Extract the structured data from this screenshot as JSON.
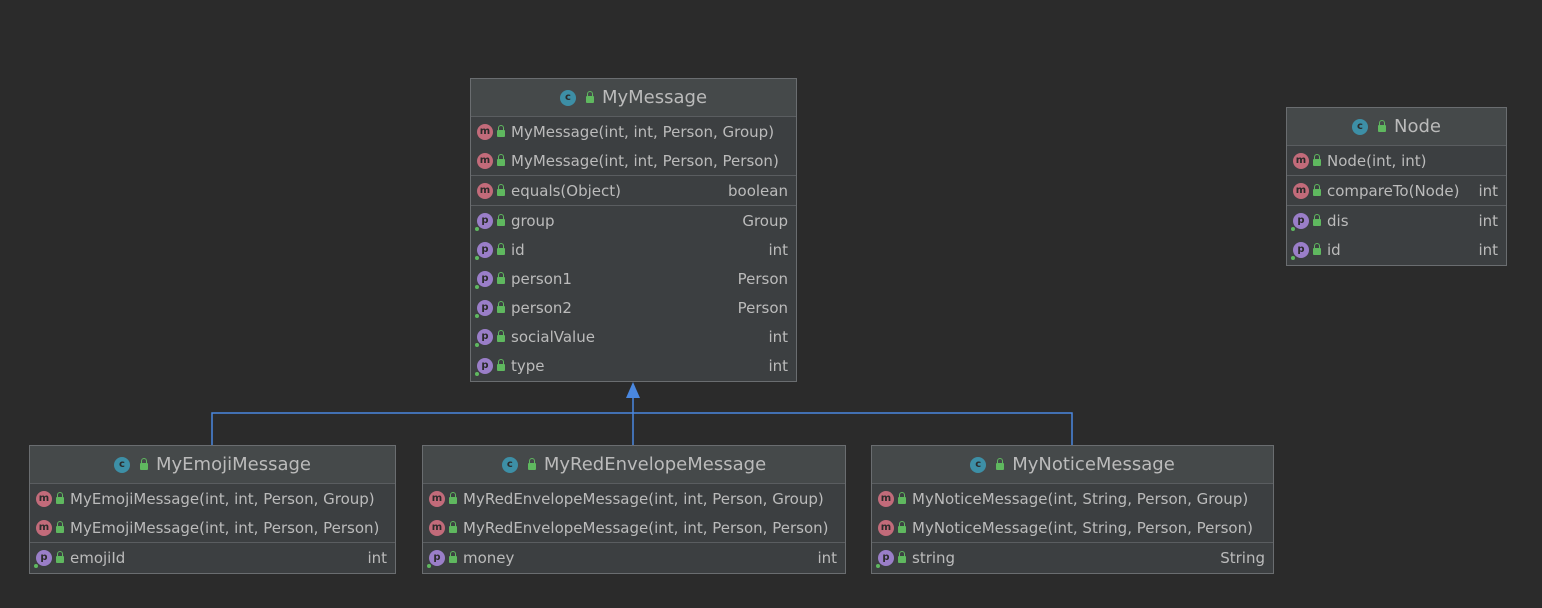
{
  "diagram": {
    "colors": {
      "background": "#2b2b2b",
      "box_fill": "#3c3f41",
      "box_border": "#6a6d70",
      "text": "#bbbbbb",
      "edge": "#4a88e0",
      "class_badge": "#3d8fa6",
      "method_badge": "#c26b7a",
      "property_badge": "#9a7ec8",
      "visibility": "#5fb85f"
    },
    "icon_letters": {
      "class": "c",
      "method": "m",
      "property": "p"
    },
    "classes": {
      "MyMessage": {
        "name": "MyMessage",
        "constructors": [
          {
            "name": "MyMessage(int, int, Person, Group)"
          },
          {
            "name": "MyMessage(int, int, Person, Person)"
          }
        ],
        "methods": [
          {
            "name": "equals(Object)",
            "type": "boolean"
          }
        ],
        "properties": [
          {
            "name": "group",
            "type": "Group"
          },
          {
            "name": "id",
            "type": "int"
          },
          {
            "name": "person1",
            "type": "Person"
          },
          {
            "name": "person2",
            "type": "Person"
          },
          {
            "name": "socialValue",
            "type": "int"
          },
          {
            "name": "type",
            "type": "int"
          }
        ]
      },
      "Node": {
        "name": "Node",
        "constructors": [
          {
            "name": "Node(int, int)"
          }
        ],
        "methods": [
          {
            "name": "compareTo(Node)",
            "type": "int"
          }
        ],
        "properties": [
          {
            "name": "dis",
            "type": "int"
          },
          {
            "name": "id",
            "type": "int"
          }
        ]
      },
      "MyEmojiMessage": {
        "name": "MyEmojiMessage",
        "constructors": [
          {
            "name": "MyEmojiMessage(int, int, Person, Group)"
          },
          {
            "name": "MyEmojiMessage(int, int, Person, Person)"
          }
        ],
        "properties": [
          {
            "name": "emojiId",
            "type": "int"
          }
        ]
      },
      "MyRedEnvelopeMessage": {
        "name": "MyRedEnvelopeMessage",
        "constructors": [
          {
            "name": "MyRedEnvelopeMessage(int, int, Person, Group)"
          },
          {
            "name": "MyRedEnvelopeMessage(int, int, Person, Person)"
          }
        ],
        "properties": [
          {
            "name": "money",
            "type": "int"
          }
        ]
      },
      "MyNoticeMessage": {
        "name": "MyNoticeMessage",
        "constructors": [
          {
            "name": "MyNoticeMessage(int, String, Person, Group)"
          },
          {
            "name": "MyNoticeMessage(int, String, Person, Person)"
          }
        ],
        "properties": [
          {
            "name": "string",
            "type": "String"
          }
        ]
      }
    },
    "inheritance": [
      {
        "child": "MyEmojiMessage",
        "parent": "MyMessage"
      },
      {
        "child": "MyRedEnvelopeMessage",
        "parent": "MyMessage"
      },
      {
        "child": "MyNoticeMessage",
        "parent": "MyMessage"
      }
    ]
  }
}
